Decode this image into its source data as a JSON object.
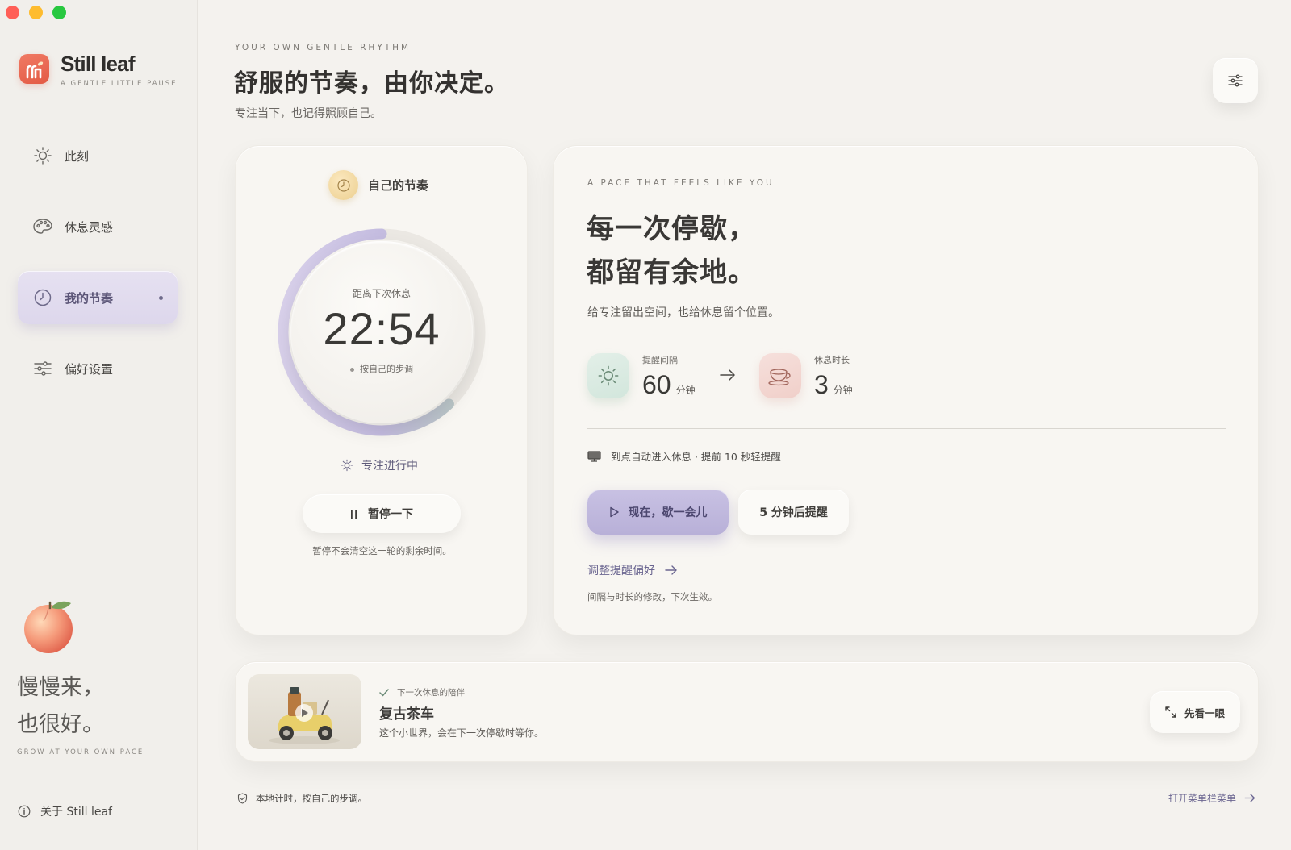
{
  "app": {
    "name": "Still leaf",
    "tagline": "A GENTLE LITTLE PAUSE"
  },
  "colors": {
    "accent": "#b8b0d8",
    "brand": "#e35a44",
    "background": "#f4f2ee"
  },
  "sidebar": {
    "items": [
      {
        "label": "此刻",
        "icon": "sun-icon",
        "active": false
      },
      {
        "label": "休息灵感",
        "icon": "palette-icon",
        "active": false
      },
      {
        "label": "我的节奏",
        "icon": "clock-icon",
        "active": true
      },
      {
        "label": "偏好设置",
        "icon": "sliders-icon",
        "active": false
      }
    ],
    "quote_line1": "慢慢来，",
    "quote_line2": "也很好。",
    "quote_sub": "GROW AT YOUR OWN PACE",
    "about": "关于 Still leaf"
  },
  "header": {
    "kicker": "YOUR OWN GENTLE RHYTHM",
    "title": "舒服的节奏，由你决定。",
    "subtitle": "专注当下，也记得照顾自己。"
  },
  "timer": {
    "heading": "自己的节奏",
    "label": "距离下次休息",
    "time": "22:54",
    "note": "按自己的步调",
    "progress": 0.62,
    "status": "专注进行中",
    "pause_label": "暂停一下",
    "pause_note": "暂停不会清空这一轮的剩余时间。"
  },
  "pace": {
    "kicker": "A PACE THAT FEELS LIKE YOU",
    "title_line1": "每一次停歇，",
    "title_line2": "都留有余地。",
    "description": "给专注留出空间，也给休息留个位置。",
    "interval_label": "提醒间隔",
    "interval_value": "60",
    "interval_unit": "分钟",
    "duration_label": "休息时长",
    "duration_value": "3",
    "duration_unit": "分钟",
    "auto_text": "到点自动进入休息 · 提前 10 秒轻提醒",
    "break_now": "现在，歇一会儿",
    "remind_later": "5 分钟后提醒",
    "adjust_link": "调整提醒偏好",
    "adjust_note": "间隔与时长的修改，下次生效。"
  },
  "companion": {
    "tag": "下一次休息的陪伴",
    "title": "复古茶车",
    "subtitle": "这个小世界，会在下一次停歇时等你。",
    "peek": "先看一眼"
  },
  "footer": {
    "left": "本地计时，按自己的步调。",
    "right": "打开菜单栏菜单"
  }
}
